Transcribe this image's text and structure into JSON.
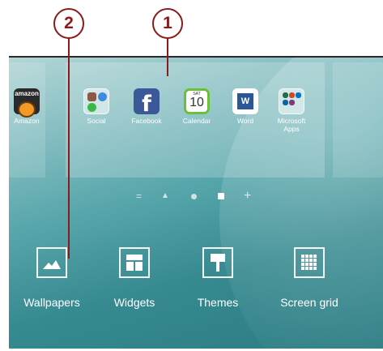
{
  "callouts": [
    "2",
    "1"
  ],
  "home_screen": {
    "apps": [
      {
        "label": "Amazon",
        "icon": "amazon-icon",
        "tile_text": "amazon"
      },
      {
        "label": "Social",
        "icon": "social-folder-icon"
      },
      {
        "label": "Facebook",
        "icon": "facebook-icon",
        "tile_text": "f"
      },
      {
        "label": "Calendar",
        "icon": "calendar-icon",
        "tile_day": "SAT",
        "tile_num": "10"
      },
      {
        "label": "Word",
        "icon": "word-icon",
        "tile_text": "W"
      },
      {
        "label": "Microsoft Apps",
        "icon": "microsoft-apps-folder-icon"
      }
    ],
    "page_indicator": {
      "pages": 5,
      "active_index": 3
    }
  },
  "options": [
    {
      "label": "Wallpapers",
      "icon": "wallpapers-icon"
    },
    {
      "label": "Widgets",
      "icon": "widgets-icon"
    },
    {
      "label": "Themes",
      "icon": "themes-icon"
    },
    {
      "label": "Screen grid",
      "icon": "screen-grid-icon"
    }
  ],
  "colors": {
    "callout": "#8b1a1a",
    "facebook": "#3b5998",
    "calendar_border": "#6cbf3a",
    "word": "#2b5797"
  }
}
